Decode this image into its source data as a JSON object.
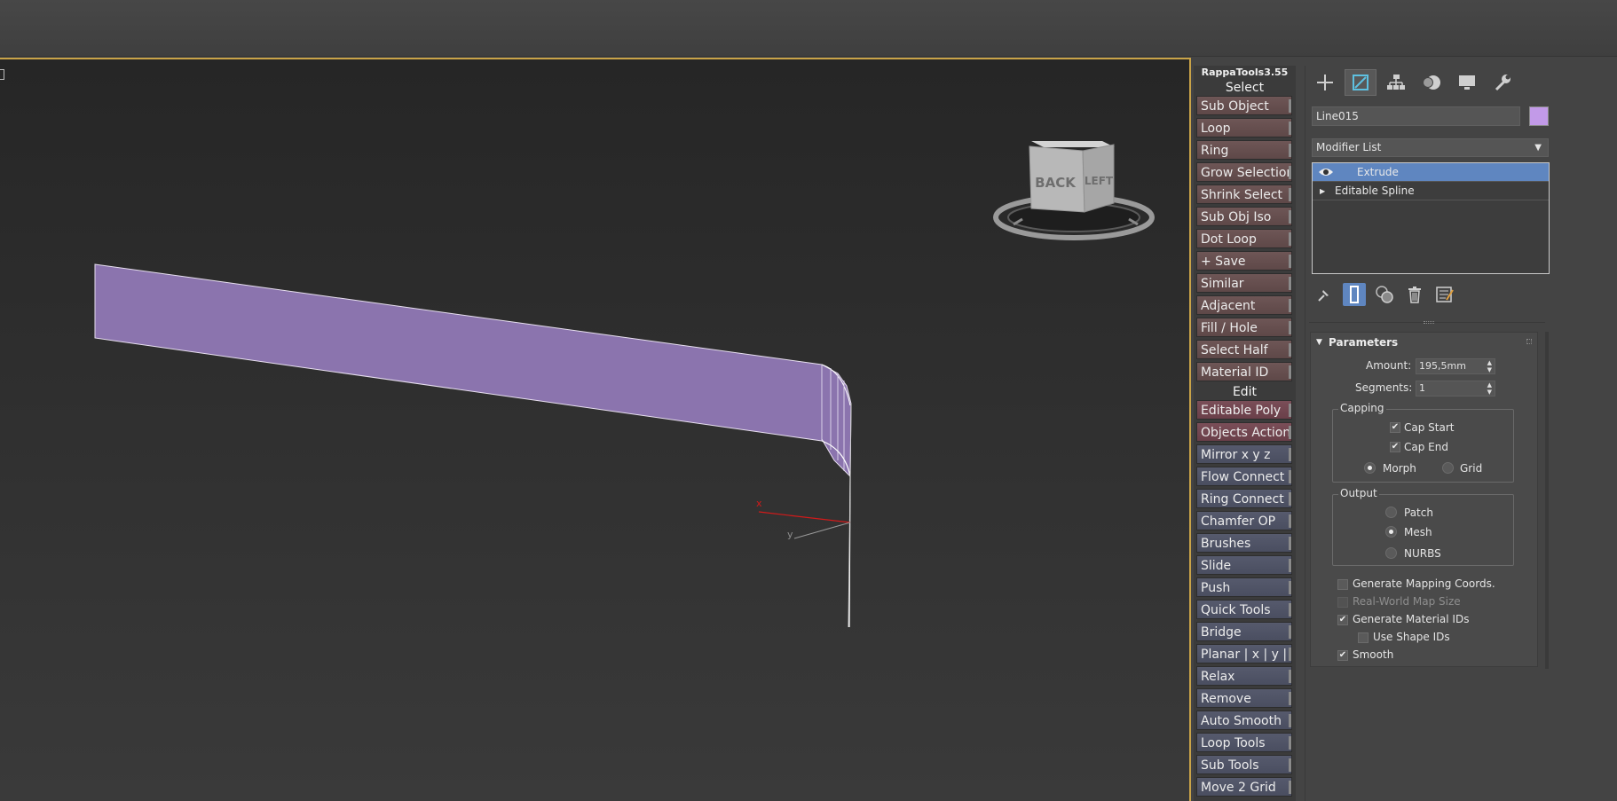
{
  "rappa": {
    "title": "RappaTools3.55",
    "select_header": "Select",
    "select_buttons": [
      "Sub Object",
      "Loop",
      "Ring",
      "Grow Selection",
      "Shrink Select",
      "Sub Obj Iso",
      "Dot Loop",
      "+ Save",
      "Similar",
      "Adjacent",
      "Fill / Hole",
      "Select Half",
      "Material ID"
    ],
    "edit_header": "Edit",
    "edit_buttons": [
      "Editable Poly",
      "Objects Actions",
      "Mirror   x  y  z",
      "Flow Connect",
      "Ring Connect",
      "Chamfer OP",
      "Brushes",
      "Slide",
      "Push",
      "Quick Tools",
      "Bridge",
      "Planar | x | y | z",
      "Relax",
      "Remove",
      "Auto Smooth",
      "Loop Tools",
      "Sub Tools",
      "Move 2 Grid"
    ]
  },
  "viewport": {
    "viewcube_faces": {
      "back": "BACK",
      "left": "LEFT"
    },
    "axis_x": "x",
    "axis_y": "y",
    "colors": {
      "object": "#8b74ae",
      "frame": "#c9a348"
    }
  },
  "command_panel": {
    "tabs": [
      "create-icon",
      "modify-icon",
      "hierarchy-icon",
      "motion-icon",
      "display-icon",
      "utilities-icon"
    ],
    "object_name": "Line015",
    "object_color": "#c29ae8",
    "modifier_list": "Modifier List",
    "stack": [
      {
        "label": "Extrude",
        "selected": true
      },
      {
        "label": "Editable Spline",
        "selected": false
      }
    ],
    "parameters": {
      "title": "Parameters",
      "amount_label": "Amount:",
      "amount_value": "195,5mm",
      "segments_label": "Segments:",
      "segments_value": "1",
      "capping_title": "Capping",
      "cap_start": "Cap Start",
      "cap_end": "Cap End",
      "morph": "Morph",
      "grid": "Grid",
      "output_title": "Output",
      "patch": "Patch",
      "mesh": "Mesh",
      "nurbs": "NURBS",
      "gen_mapping": "Generate Mapping Coords.",
      "real_world": "Real-World Map Size",
      "gen_material": "Generate Material IDs",
      "use_shape": "Use Shape IDs",
      "smooth": "Smooth"
    }
  }
}
